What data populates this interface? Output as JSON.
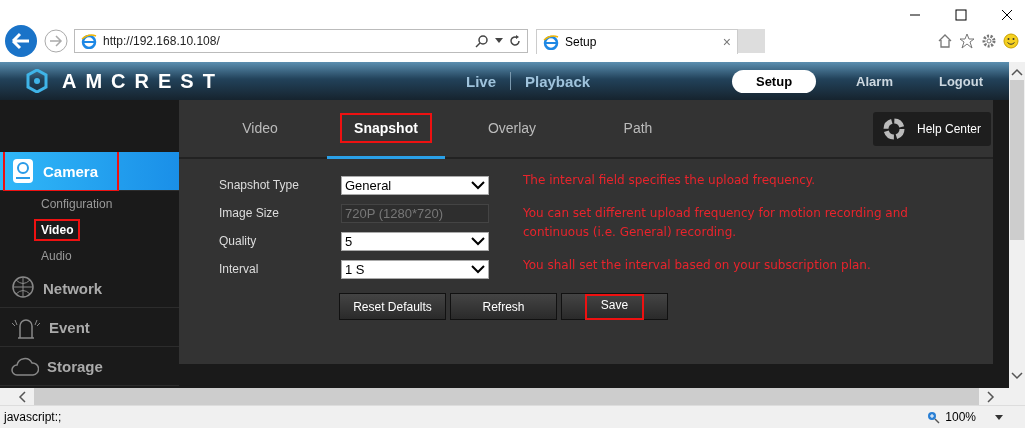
{
  "browser": {
    "address": "http://192.168.10.108/",
    "tab_title": "Setup",
    "tab_close": "×",
    "status_text": "javascript:;",
    "zoom": "100%"
  },
  "header": {
    "logo": "AMCREST",
    "nav": [
      {
        "label": "Live",
        "selected": false
      },
      {
        "label": "Playback",
        "selected": false
      }
    ],
    "right_nav": [
      {
        "label": "Setup",
        "selected": true
      },
      {
        "label": "Alarm",
        "selected": false
      },
      {
        "label": "Logout",
        "selected": false
      }
    ]
  },
  "tabs": [
    {
      "label": "Video",
      "selected": false,
      "annotated": false
    },
    {
      "label": "Snapshot",
      "selected": true,
      "annotated": true
    },
    {
      "label": "Overlay",
      "selected": false,
      "annotated": false
    },
    {
      "label": "Path",
      "selected": false,
      "annotated": false
    }
  ],
  "help_center": "Help Center",
  "sidebar": [
    {
      "label": "Camera",
      "kind": "camera",
      "selected": true,
      "annotated": true,
      "children": [
        {
          "label": "Configuration",
          "selected": false,
          "annotated": false
        },
        {
          "label": "Video",
          "selected": true,
          "annotated": true
        },
        {
          "label": "Audio",
          "selected": false,
          "annotated": false
        }
      ]
    },
    {
      "label": "Network",
      "kind": "network",
      "selected": false,
      "annotated": false
    },
    {
      "label": "Event",
      "kind": "event",
      "selected": false,
      "annotated": false
    },
    {
      "label": "Storage",
      "kind": "storage",
      "selected": false,
      "annotated": false
    }
  ],
  "form": [
    {
      "label": "Snapshot Type",
      "value": "General",
      "disabled": false
    },
    {
      "label": "Image Size",
      "value": "720P (1280*720)",
      "disabled": true
    },
    {
      "label": "Quality",
      "value": "5",
      "disabled": false
    },
    {
      "label": "Interval",
      "value": "1 S",
      "disabled": false
    }
  ],
  "buttons": [
    {
      "label": "Reset Defaults",
      "annotated": false
    },
    {
      "label": "Refresh",
      "annotated": false
    },
    {
      "label": "Save",
      "annotated": true
    }
  ],
  "notes": [
    "The interval field specifies the upload frequency.",
    "You can set different upload frequency for motion recording and continuous (i.e. General)  recording.",
    "You shall set the interval based on your subscription plan."
  ]
}
